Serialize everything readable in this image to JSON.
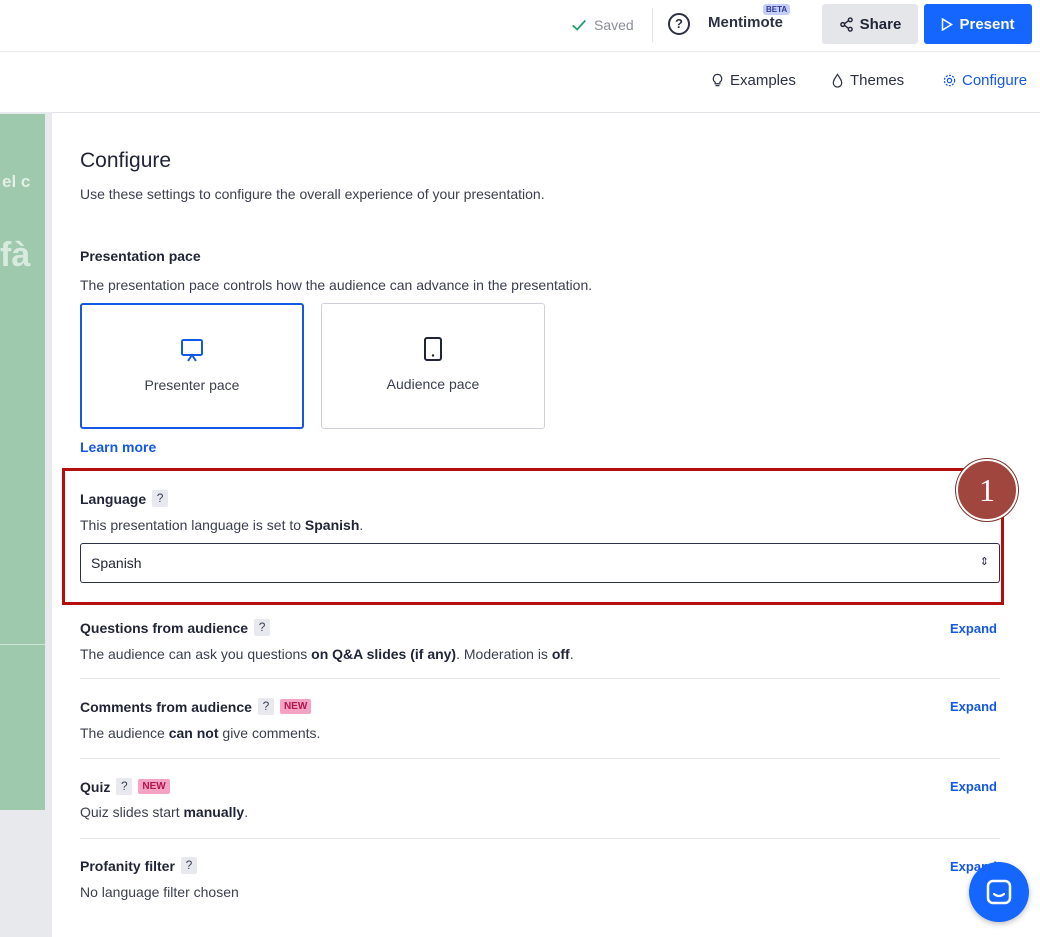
{
  "topbar": {
    "saved_label": "Saved",
    "mentimote_label": "Mentimote",
    "beta_label": "BETA",
    "share_label": "Share",
    "present_label": "Present"
  },
  "subtabs": {
    "examples": "Examples",
    "themes": "Themes",
    "configure": "Configure"
  },
  "slide_preview": {
    "text1": "el c",
    "text2": "fà"
  },
  "panel": {
    "title": "Configure",
    "description": "Use these settings to configure the overall experience of your presentation."
  },
  "pace": {
    "title": "Presentation pace",
    "description": "The presentation pace controls how the audience can advance in the presentation.",
    "options": [
      {
        "label": "Presenter pace",
        "selected": true
      },
      {
        "label": "Audience pace",
        "selected": false
      }
    ],
    "learn_more": "Learn more"
  },
  "language": {
    "title": "Language",
    "help": "?",
    "desc_prefix": "This presentation language is set to ",
    "desc_value": "Spanish",
    "desc_suffix": ".",
    "selected": "Spanish"
  },
  "questions": {
    "title": "Questions from audience",
    "help": "?",
    "desc_a": "The audience can ask you questions ",
    "desc_b": "on Q&A slides (if any)",
    "desc_c": ". Moderation is ",
    "desc_d": "off",
    "desc_e": ".",
    "expand": "Expand"
  },
  "comments": {
    "title": "Comments from audience",
    "help": "?",
    "new": "NEW",
    "desc_a": "The audience ",
    "desc_b": "can not",
    "desc_c": " give comments.",
    "expand": "Expand"
  },
  "quiz": {
    "title": "Quiz",
    "help": "?",
    "new": "NEW",
    "desc_a": "Quiz slides start ",
    "desc_b": "manually",
    "desc_c": ".",
    "expand": "Expand"
  },
  "profanity": {
    "title": "Profanity filter",
    "help": "?",
    "desc": "No language filter chosen",
    "expand": "Expand"
  },
  "annotation": {
    "badge": "1"
  },
  "colors": {
    "accent": "#1466ff",
    "highlight": "#b50e0e",
    "badge": "#a0463f"
  }
}
